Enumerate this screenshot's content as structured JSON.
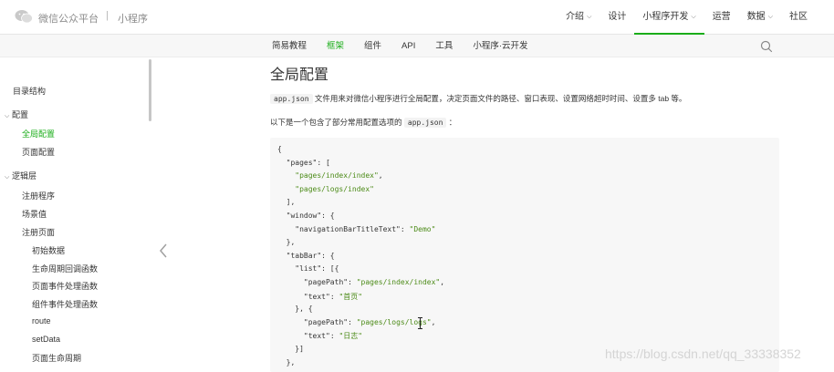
{
  "header": {
    "brand": "微信公众平台",
    "separator": "|",
    "sub_brand": "小程序",
    "nav": [
      {
        "label": "介绍",
        "caret": true
      },
      {
        "label": "设计",
        "caret": false
      },
      {
        "label": "小程序开发",
        "caret": true,
        "active": true
      },
      {
        "label": "运营",
        "caret": false
      },
      {
        "label": "数据",
        "caret": true
      },
      {
        "label": "社区",
        "caret": false
      }
    ],
    "caret_glyph": "⌵"
  },
  "subnav": {
    "tabs": [
      {
        "label": "简易教程"
      },
      {
        "label": "框架",
        "active": true
      },
      {
        "label": "组件"
      },
      {
        "label": "API"
      },
      {
        "label": "工具"
      },
      {
        "label": "小程序·云开发"
      }
    ]
  },
  "sidebar": {
    "items": [
      {
        "label": "目录结构"
      },
      {
        "label": "配置",
        "twisty": "⌵"
      },
      {
        "label": "全局配置",
        "active": true
      },
      {
        "label": "页面配置"
      },
      {
        "label": "逻辑层",
        "twisty": "⌵"
      },
      {
        "label": "注册程序"
      },
      {
        "label": "场景值"
      },
      {
        "label": "注册页面"
      },
      {
        "label": "初始数据"
      },
      {
        "label": "生命周期回调函数"
      },
      {
        "label": "页面事件处理函数"
      },
      {
        "label": "组件事件处理函数"
      },
      {
        "label": "route"
      },
      {
        "label": "setData"
      },
      {
        "label": "页面生命周期"
      }
    ]
  },
  "content": {
    "title": "全局配置",
    "intro_code": "app.json",
    "intro_text": " 文件用来对微信小程序进行全局配置，决定页面文件的路径、窗口表现、设置网络超时时间、设置多 tab 等。",
    "example_text": "以下是一个包含了部分常用配置选项的 ",
    "example_code": "app.json",
    "example_suffix": " ：",
    "code_lines": [
      [
        [
          "p",
          "{"
        ]
      ],
      [
        [
          "p",
          "  "
        ],
        [
          "k",
          "\"pages\""
        ],
        [
          "p",
          ": ["
        ]
      ],
      [
        [
          "p",
          "    "
        ],
        [
          "s",
          "\"pages/index/index\""
        ],
        [
          "p",
          ","
        ]
      ],
      [
        [
          "p",
          "    "
        ],
        [
          "s",
          "\"pages/logs/index\""
        ]
      ],
      [
        [
          "p",
          "  ],"
        ]
      ],
      [
        [
          "p",
          "  "
        ],
        [
          "k",
          "\"window\""
        ],
        [
          "p",
          ": {"
        ]
      ],
      [
        [
          "p",
          "    "
        ],
        [
          "k",
          "\"navigationBarTitleText\""
        ],
        [
          "p",
          ": "
        ],
        [
          "s",
          "\"Demo\""
        ]
      ],
      [
        [
          "p",
          "  },"
        ]
      ],
      [
        [
          "p",
          "  "
        ],
        [
          "k",
          "\"tabBar\""
        ],
        [
          "p",
          ": {"
        ]
      ],
      [
        [
          "p",
          "    "
        ],
        [
          "k",
          "\"list\""
        ],
        [
          "p",
          ": [{"
        ]
      ],
      [
        [
          "p",
          "      "
        ],
        [
          "k",
          "\"pagePath\""
        ],
        [
          "p",
          ": "
        ],
        [
          "s",
          "\"pages/index/index\""
        ],
        [
          "p",
          ","
        ]
      ],
      [
        [
          "p",
          "      "
        ],
        [
          "k",
          "\"text\""
        ],
        [
          "p",
          ": "
        ],
        [
          "s",
          "\"首页\""
        ]
      ],
      [
        [
          "p",
          "    }, {"
        ]
      ],
      [
        [
          "p",
          "      "
        ],
        [
          "k",
          "\"pagePath\""
        ],
        [
          "p",
          ": "
        ],
        [
          "s",
          "\"pages/logs/logs\""
        ],
        [
          "p",
          ","
        ]
      ],
      [
        [
          "p",
          "      "
        ],
        [
          "k",
          "\"text\""
        ],
        [
          "p",
          ": "
        ],
        [
          "s",
          "\"日志\""
        ]
      ],
      [
        [
          "p",
          "    }]"
        ]
      ],
      [
        [
          "p",
          "  },"
        ]
      ]
    ]
  },
  "watermark": "https://blog.csdn.net/qq_33338352",
  "colors": {
    "accent": "#1aad19",
    "string": "#4c8b18",
    "text": "#353535",
    "code_bg": "#f7f7f7"
  }
}
